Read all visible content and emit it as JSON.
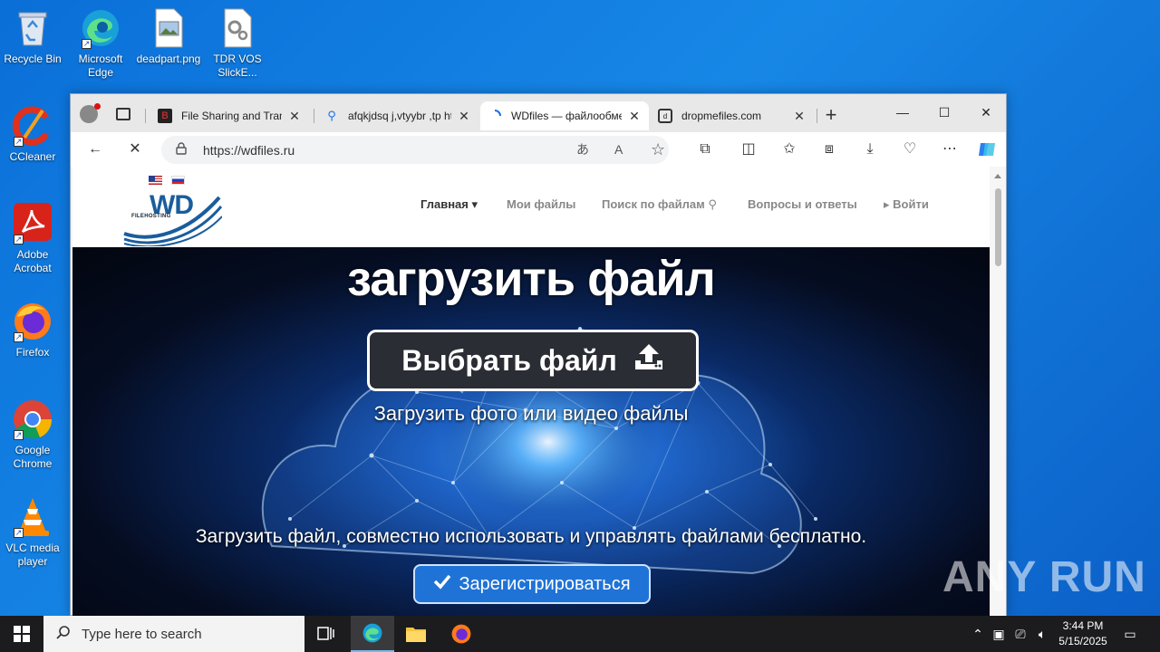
{
  "desktop": {
    "icons": [
      {
        "label": "Recycle Bin",
        "icon": "recycle-bin-icon"
      },
      {
        "label": "Microsoft Edge",
        "icon": "edge-icon"
      },
      {
        "label": "deadpart.png",
        "icon": "image-file-icon"
      },
      {
        "label": "TDR VOS SlickE...",
        "icon": "settings-file-icon"
      },
      {
        "label": "CCleaner",
        "icon": "ccleaner-icon"
      },
      {
        "label": "Adobe Acrobat",
        "icon": "acrobat-icon"
      },
      {
        "label": "Firefox",
        "icon": "firefox-icon"
      },
      {
        "label": "Google Chrome",
        "icon": "chrome-icon"
      },
      {
        "label": "VLC media player",
        "icon": "vlc-icon"
      }
    ]
  },
  "browser": {
    "tabs": [
      {
        "title": "File Sharing and Transfer",
        "favicon": "bitdefender-icon"
      },
      {
        "title": "afqkjdsq j,vtyybr ,tp htt",
        "favicon": "search-icon"
      },
      {
        "title": "WDfiles — файлообменник",
        "favicon": "loading-spinner-icon",
        "active": true
      },
      {
        "title": "dropmefiles.com",
        "favicon": "dropmefiles-icon"
      }
    ],
    "new_tab": "+",
    "address": "https://wdfiles.ru",
    "window_controls": {
      "minimize": "—",
      "maximize": "☐",
      "close": "✕"
    }
  },
  "site": {
    "logo": {
      "main": "WD",
      "sub": "FILEHOSTING"
    },
    "nav": [
      {
        "label": "Главная ▾",
        "active": true
      },
      {
        "label": "Мои файлы"
      },
      {
        "label": "Поиск по файлам ⚲"
      },
      {
        "label": "Вопросы и ответы"
      },
      {
        "label": "▸ Войти"
      }
    ],
    "hero": {
      "title": "загрузить файл",
      "choose_button": "Выбрать файл",
      "subtitle": "Загрузить фото или видео файлы",
      "tagline": "Загрузить файл, совместно использовать и управлять файлами бесплатно.",
      "register_button": "Зарегистрироваться"
    }
  },
  "taskbar": {
    "search_placeholder": "Type here to search",
    "time": "3:44 PM",
    "date": "5/15/2025"
  },
  "watermark": "ANY RUN",
  "colors": {
    "desktop": "#1787e6",
    "accent": "#1f73d6",
    "button_dark": "#2a2d33"
  }
}
